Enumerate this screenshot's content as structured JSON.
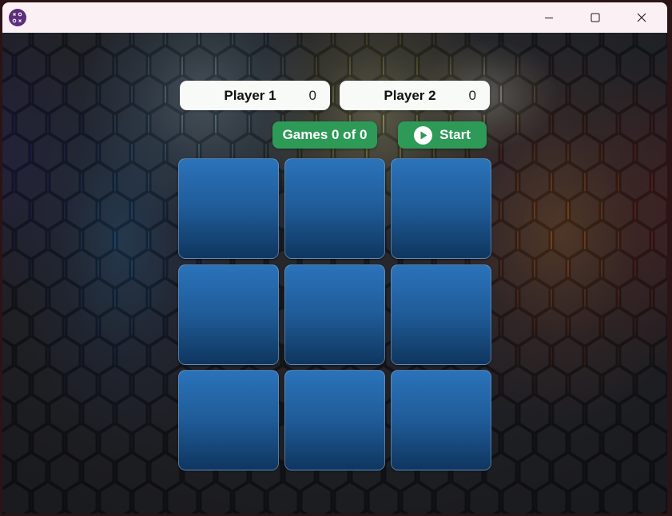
{
  "window": {
    "app_icon": "xo-game-icon",
    "controls": [
      "minimize-icon",
      "maximize-icon",
      "close-icon"
    ]
  },
  "scoreboard": {
    "player1": {
      "label": "Player 1",
      "score": "0"
    },
    "player2": {
      "label": "Player 2",
      "score": "0"
    }
  },
  "games": {
    "label": "Games 0 of 0"
  },
  "start_button": {
    "label": "Start",
    "icon": "play-icon"
  },
  "board": {
    "cells": [
      "",
      "",
      "",
      "",
      "",
      "",
      "",
      "",
      ""
    ]
  },
  "colors": {
    "green_button": "#2e9a57",
    "cell_top": "#2b73ba",
    "cell_bottom": "#0f365f",
    "score_bg": "#f7faf7",
    "titlebar_bg": "#fbf1f4"
  }
}
